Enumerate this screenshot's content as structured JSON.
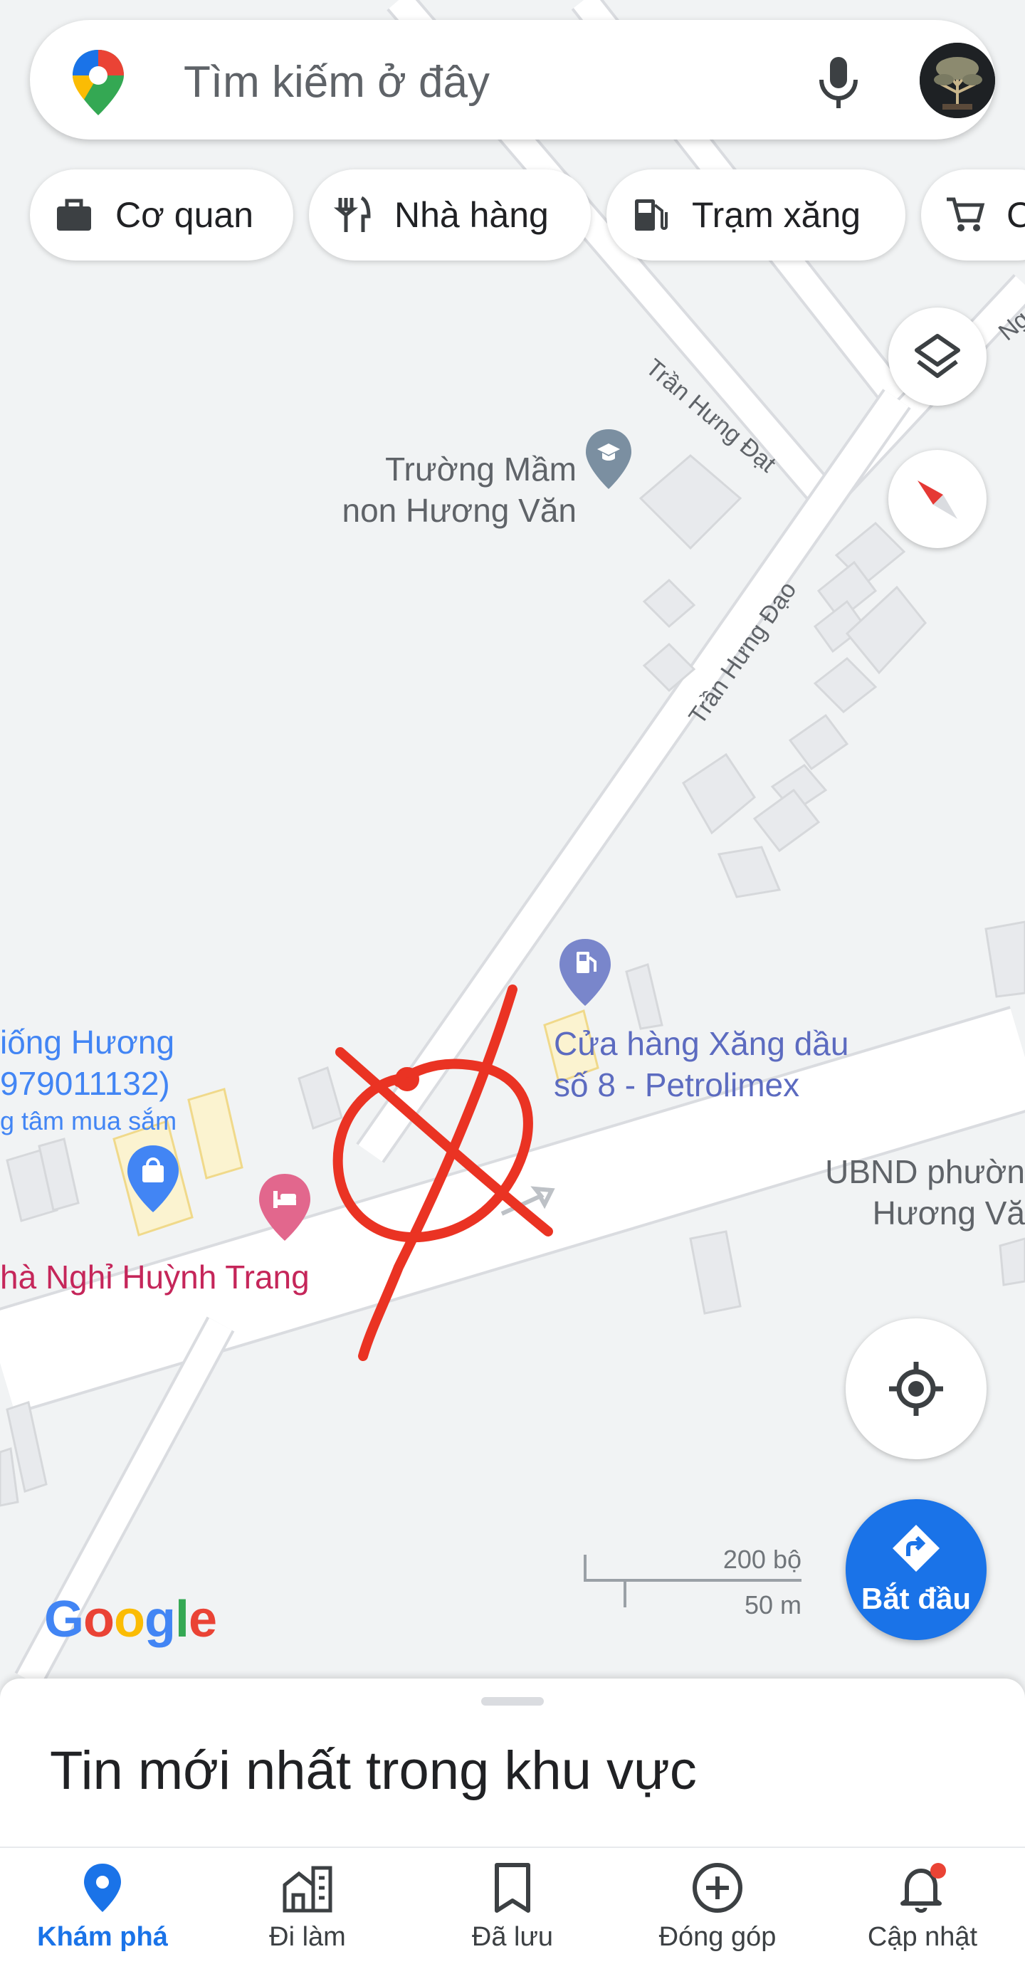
{
  "search": {
    "placeholder": "Tìm kiếm ở đây"
  },
  "chips": [
    {
      "label": "Cơ quan",
      "icon": "briefcase-icon"
    },
    {
      "label": "Nhà hàng",
      "icon": "restaurant-icon"
    },
    {
      "label": "Trạm xăng",
      "icon": "gas-station-icon"
    },
    {
      "label": "C",
      "icon": "cart-icon"
    }
  ],
  "map": {
    "roads": [
      {
        "label": "Trần Hưng Đạt"
      },
      {
        "label": "Trần Hưng Đạo"
      },
      {
        "label": "Ng"
      }
    ],
    "places": {
      "school": {
        "line1": "Trường Mầm",
        "line2": "non Hương Văn",
        "icon": "school-icon"
      },
      "gas": {
        "line1": "Cửa hàng Xăng dầu",
        "line2": "số 8 - Petrolimex",
        "icon": "gas-pin-icon"
      },
      "ubnd": {
        "line1": "UBND phườn",
        "line2": "Hương Vă"
      },
      "shop": {
        "line1": "iống Hương",
        "line2": "979011132)",
        "line3": "g tâm mua sắm",
        "icon": "shopping-pin-icon"
      },
      "hotel": {
        "line1": "hà Nghỉ Huỳnh Trang",
        "icon": "hotel-pin-icon"
      }
    },
    "scale": {
      "imperial": "200 bộ",
      "metric": "50 m"
    },
    "logo": "Google"
  },
  "controls": {
    "start_label": "Bắt đầu"
  },
  "sheet": {
    "title": "Tin mới nhất trong khu vực"
  },
  "nav": [
    {
      "label": "Khám phá",
      "icon": "explore-pin-icon",
      "active": true
    },
    {
      "label": "Đi làm",
      "icon": "commute-icon",
      "active": false
    },
    {
      "label": "Đã lưu",
      "icon": "bookmark-icon",
      "active": false
    },
    {
      "label": "Đóng góp",
      "icon": "contribute-icon",
      "active": false
    },
    {
      "label": "Cập nhật",
      "icon": "notification-bell-icon",
      "active": false
    }
  ],
  "colors": {
    "accent": "#1a73e8",
    "annotation": "#ea3323",
    "hotel": "#c5265a",
    "gas_label": "#5c6bc0"
  }
}
